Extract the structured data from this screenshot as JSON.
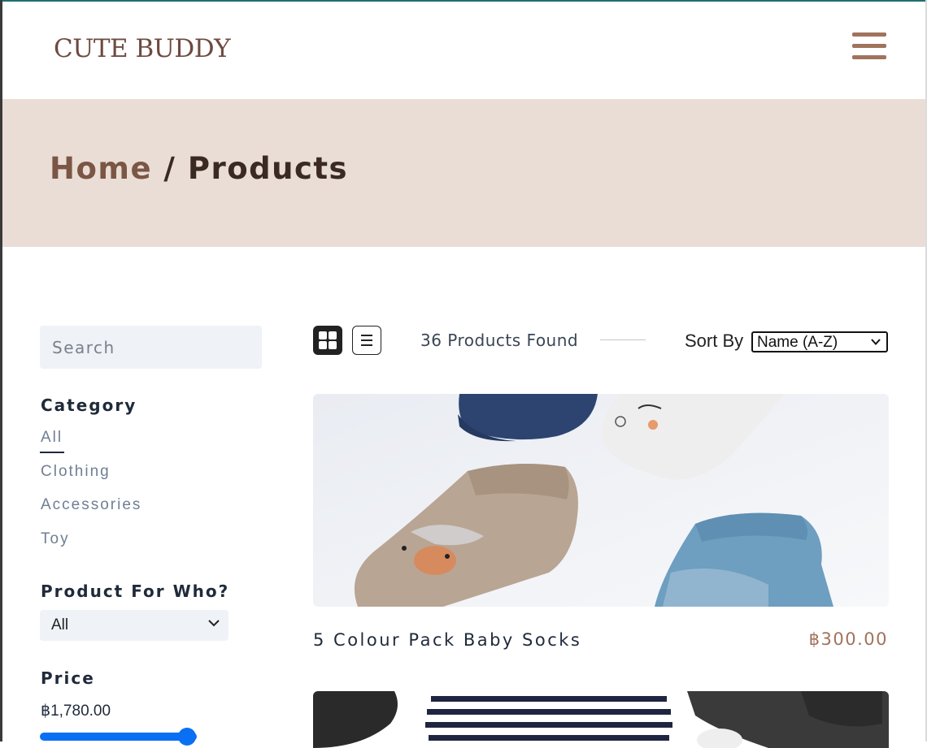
{
  "header": {
    "logo": "CUTE BUDDY"
  },
  "banner": {
    "home": "Home",
    "separator": " / ",
    "current": "Products"
  },
  "sidebar": {
    "search_placeholder": "Search",
    "category_heading": "Category",
    "categories": [
      "All",
      "Clothing",
      "Accessories",
      "Toy"
    ],
    "who_heading": "Product For Who?",
    "who_selected": "All",
    "price_heading": "Price",
    "price_value": "฿1,780.00"
  },
  "toolbar": {
    "found_text": "36 Products Found",
    "sort_label": "Sort By",
    "sort_selected": "Name (A-Z)"
  },
  "products": [
    {
      "name": "5 Colour Pack Baby Socks",
      "price": "฿300.00"
    }
  ],
  "colors": {
    "brand": "#6e4a3f",
    "accent": "#a0735c",
    "banner_bg": "#eaddd6",
    "slider": "#0a70f3"
  }
}
